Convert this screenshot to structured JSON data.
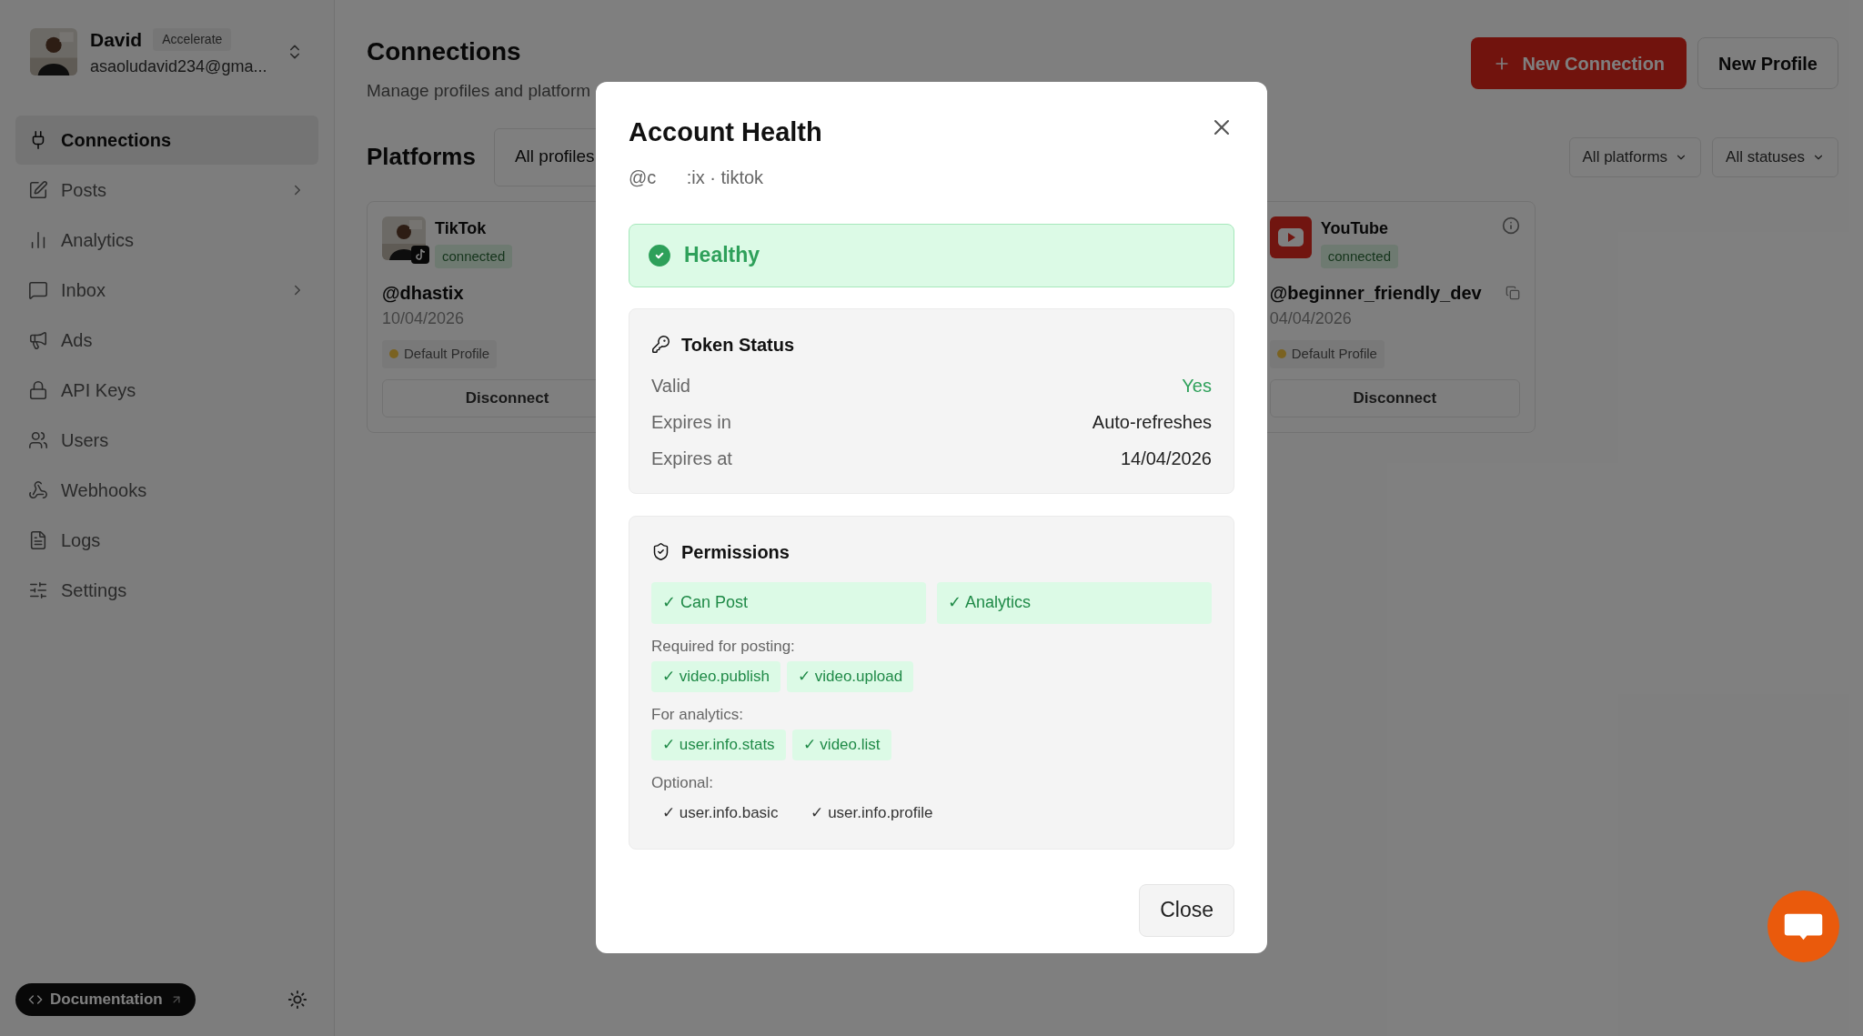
{
  "user": {
    "name": "David",
    "plan": "Accelerate",
    "email": "asaoludavid234@gma..."
  },
  "sidebar": {
    "items": [
      {
        "label": "Connections",
        "selected": true,
        "submenu": false
      },
      {
        "label": "Posts",
        "selected": false,
        "submenu": true
      },
      {
        "label": "Analytics",
        "selected": false,
        "submenu": false
      },
      {
        "label": "Inbox",
        "selected": false,
        "submenu": true
      },
      {
        "label": "Ads",
        "selected": false,
        "submenu": false
      },
      {
        "label": "API Keys",
        "selected": false,
        "submenu": false
      },
      {
        "label": "Users",
        "selected": false,
        "submenu": false
      },
      {
        "label": "Webhooks",
        "selected": false,
        "submenu": false
      },
      {
        "label": "Logs",
        "selected": false,
        "submenu": false
      },
      {
        "label": "Settings",
        "selected": false,
        "submenu": false
      }
    ]
  },
  "documentation_button": "Documentation",
  "header": {
    "title": "Connections",
    "subtitle": "Manage profiles and platform",
    "buttons": [
      {
        "label": "New Connection",
        "kind": "primary"
      },
      {
        "label": "New Profile",
        "kind": "secondary"
      }
    ]
  },
  "platforms": {
    "title": "Platforms",
    "profile_filter": "All profiles",
    "filters": [
      "All platforms",
      "All statuses"
    ],
    "cards": [
      {
        "kind": "tiktok",
        "platform": "TikTok",
        "status": "connected",
        "handle": "@dhastix",
        "date": "10/04/2026",
        "tag": "Default Profile",
        "button": "Disconnect"
      },
      {
        "kind": "youtube",
        "platform": "YouTube",
        "status": "connected",
        "handle": "@beginner_friendly_dev",
        "date": "04/04/2026",
        "tag": "Default Profile",
        "button": "Disconnect"
      }
    ]
  },
  "dialog": {
    "title": "Account Health",
    "subtitle": "@c      :ix · tiktok",
    "status": {
      "label": "Healthy",
      "kind": "healthy"
    },
    "token": {
      "title": "Token Status",
      "rows": [
        {
          "label": "Valid",
          "value": "Yes",
          "kind": "positive"
        },
        {
          "label": "Expires in",
          "value": "Auto-refreshes",
          "kind": "plain"
        },
        {
          "label": "Expires at",
          "value": "14/04/2026",
          "kind": "plain"
        }
      ]
    },
    "permissions": {
      "title": "Permissions",
      "capabilities": [
        "✓ Can Post",
        "✓ Analytics"
      ],
      "groups": [
        {
          "label": "Required for posting:",
          "kind": "granted",
          "scopes": [
            "✓ video.publish",
            "✓ video.upload"
          ]
        },
        {
          "label": "For analytics:",
          "kind": "granted",
          "scopes": [
            "✓ user.info.stats",
            "✓ video.list"
          ]
        },
        {
          "label": "Optional:",
          "kind": "optional",
          "scopes": [
            "✓ user.info.basic",
            "✓ user.info.profile"
          ]
        }
      ]
    },
    "close_button": "Close"
  }
}
